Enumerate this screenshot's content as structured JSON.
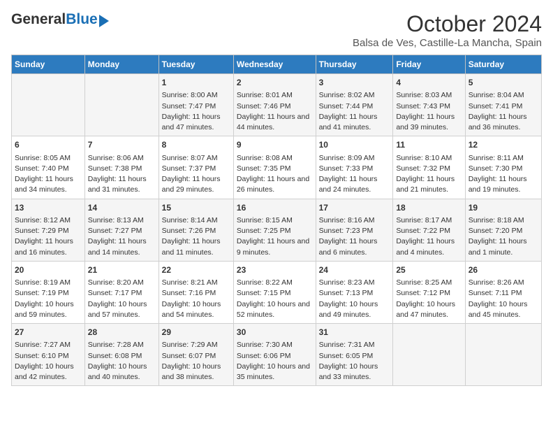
{
  "header": {
    "logo_general": "General",
    "logo_blue": "Blue",
    "title": "October 2024",
    "subtitle": "Balsa de Ves, Castille-La Mancha, Spain"
  },
  "days_of_week": [
    "Sunday",
    "Monday",
    "Tuesday",
    "Wednesday",
    "Thursday",
    "Friday",
    "Saturday"
  ],
  "weeks": [
    [
      {
        "day": "",
        "info": ""
      },
      {
        "day": "",
        "info": ""
      },
      {
        "day": "1",
        "info": "Sunrise: 8:00 AM\nSunset: 7:47 PM\nDaylight: 11 hours and 47 minutes."
      },
      {
        "day": "2",
        "info": "Sunrise: 8:01 AM\nSunset: 7:46 PM\nDaylight: 11 hours and 44 minutes."
      },
      {
        "day": "3",
        "info": "Sunrise: 8:02 AM\nSunset: 7:44 PM\nDaylight: 11 hours and 41 minutes."
      },
      {
        "day": "4",
        "info": "Sunrise: 8:03 AM\nSunset: 7:43 PM\nDaylight: 11 hours and 39 minutes."
      },
      {
        "day": "5",
        "info": "Sunrise: 8:04 AM\nSunset: 7:41 PM\nDaylight: 11 hours and 36 minutes."
      }
    ],
    [
      {
        "day": "6",
        "info": "Sunrise: 8:05 AM\nSunset: 7:40 PM\nDaylight: 11 hours and 34 minutes."
      },
      {
        "day": "7",
        "info": "Sunrise: 8:06 AM\nSunset: 7:38 PM\nDaylight: 11 hours and 31 minutes."
      },
      {
        "day": "8",
        "info": "Sunrise: 8:07 AM\nSunset: 7:37 PM\nDaylight: 11 hours and 29 minutes."
      },
      {
        "day": "9",
        "info": "Sunrise: 8:08 AM\nSunset: 7:35 PM\nDaylight: 11 hours and 26 minutes."
      },
      {
        "day": "10",
        "info": "Sunrise: 8:09 AM\nSunset: 7:33 PM\nDaylight: 11 hours and 24 minutes."
      },
      {
        "day": "11",
        "info": "Sunrise: 8:10 AM\nSunset: 7:32 PM\nDaylight: 11 hours and 21 minutes."
      },
      {
        "day": "12",
        "info": "Sunrise: 8:11 AM\nSunset: 7:30 PM\nDaylight: 11 hours and 19 minutes."
      }
    ],
    [
      {
        "day": "13",
        "info": "Sunrise: 8:12 AM\nSunset: 7:29 PM\nDaylight: 11 hours and 16 minutes."
      },
      {
        "day": "14",
        "info": "Sunrise: 8:13 AM\nSunset: 7:27 PM\nDaylight: 11 hours and 14 minutes."
      },
      {
        "day": "15",
        "info": "Sunrise: 8:14 AM\nSunset: 7:26 PM\nDaylight: 11 hours and 11 minutes."
      },
      {
        "day": "16",
        "info": "Sunrise: 8:15 AM\nSunset: 7:25 PM\nDaylight: 11 hours and 9 minutes."
      },
      {
        "day": "17",
        "info": "Sunrise: 8:16 AM\nSunset: 7:23 PM\nDaylight: 11 hours and 6 minutes."
      },
      {
        "day": "18",
        "info": "Sunrise: 8:17 AM\nSunset: 7:22 PM\nDaylight: 11 hours and 4 minutes."
      },
      {
        "day": "19",
        "info": "Sunrise: 8:18 AM\nSunset: 7:20 PM\nDaylight: 11 hours and 1 minute."
      }
    ],
    [
      {
        "day": "20",
        "info": "Sunrise: 8:19 AM\nSunset: 7:19 PM\nDaylight: 10 hours and 59 minutes."
      },
      {
        "day": "21",
        "info": "Sunrise: 8:20 AM\nSunset: 7:17 PM\nDaylight: 10 hours and 57 minutes."
      },
      {
        "day": "22",
        "info": "Sunrise: 8:21 AM\nSunset: 7:16 PM\nDaylight: 10 hours and 54 minutes."
      },
      {
        "day": "23",
        "info": "Sunrise: 8:22 AM\nSunset: 7:15 PM\nDaylight: 10 hours and 52 minutes."
      },
      {
        "day": "24",
        "info": "Sunrise: 8:23 AM\nSunset: 7:13 PM\nDaylight: 10 hours and 49 minutes."
      },
      {
        "day": "25",
        "info": "Sunrise: 8:25 AM\nSunset: 7:12 PM\nDaylight: 10 hours and 47 minutes."
      },
      {
        "day": "26",
        "info": "Sunrise: 8:26 AM\nSunset: 7:11 PM\nDaylight: 10 hours and 45 minutes."
      }
    ],
    [
      {
        "day": "27",
        "info": "Sunrise: 7:27 AM\nSunset: 6:10 PM\nDaylight: 10 hours and 42 minutes."
      },
      {
        "day": "28",
        "info": "Sunrise: 7:28 AM\nSunset: 6:08 PM\nDaylight: 10 hours and 40 minutes."
      },
      {
        "day": "29",
        "info": "Sunrise: 7:29 AM\nSunset: 6:07 PM\nDaylight: 10 hours and 38 minutes."
      },
      {
        "day": "30",
        "info": "Sunrise: 7:30 AM\nSunset: 6:06 PM\nDaylight: 10 hours and 35 minutes."
      },
      {
        "day": "31",
        "info": "Sunrise: 7:31 AM\nSunset: 6:05 PM\nDaylight: 10 hours and 33 minutes."
      },
      {
        "day": "",
        "info": ""
      },
      {
        "day": "",
        "info": ""
      }
    ]
  ]
}
